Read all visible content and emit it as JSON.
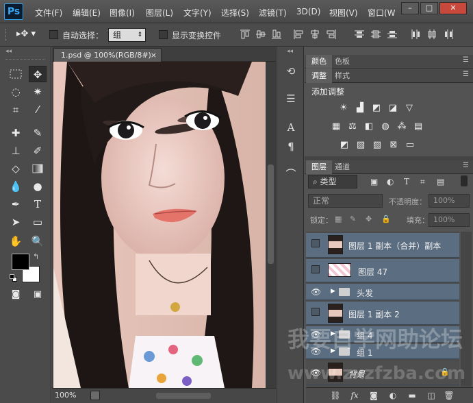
{
  "app": {
    "logo": "Ps"
  },
  "menu": [
    "文件(F)",
    "编辑(E)",
    "图像(I)",
    "图层(L)",
    "文字(Y)",
    "选择(S)",
    "滤镜(T)",
    "3D(D)",
    "视图(V)",
    "窗口(W"
  ],
  "window_buttons": {
    "minimize": "–",
    "restore": "□",
    "close": "✕"
  },
  "options": {
    "auto_select_label": "自动选择：",
    "auto_select_value": "组",
    "show_transform_label": "显示变换控件"
  },
  "document": {
    "tab_title": "1.psd @ 100%(RGB/8#)",
    "tab_close": "×",
    "zoom": "100%"
  },
  "panels": {
    "color_tabs": [
      "颜色",
      "色板"
    ],
    "adjust_tabs": [
      "调整",
      "样式"
    ],
    "adjust_title": "添加调整",
    "layers_tabs": [
      "图层",
      "通道"
    ],
    "filter_kind": "类型",
    "blend_mode": "正常",
    "opacity_label": "不透明度：",
    "opacity_value": "100%",
    "lock_label": "锁定：",
    "fill_label": "填充：",
    "fill_value": "100%"
  },
  "layers": [
    {
      "name": "图层 1 副本（合并）副本",
      "visible": false,
      "kind": "photo"
    },
    {
      "name": "图层 47",
      "visible": false,
      "kind": "pattern"
    },
    {
      "name": "头发",
      "visible": true,
      "kind": "group"
    },
    {
      "name": "图层 1 副本 2",
      "visible": false,
      "kind": "photo"
    },
    {
      "name": "组 4",
      "visible": true,
      "kind": "group"
    },
    {
      "name": "组 1",
      "visible": true,
      "kind": "group"
    },
    {
      "name": "背景",
      "visible": true,
      "kind": "background"
    }
  ],
  "watermark": {
    "line1": "我要自学网助论坛",
    "line2": "www.zxzfzba.com"
  },
  "colors": {
    "selected_layer": "#5b6d80",
    "ps_blue": "#3aa7f3",
    "foreground": "#000000",
    "background": "#ffffff"
  }
}
